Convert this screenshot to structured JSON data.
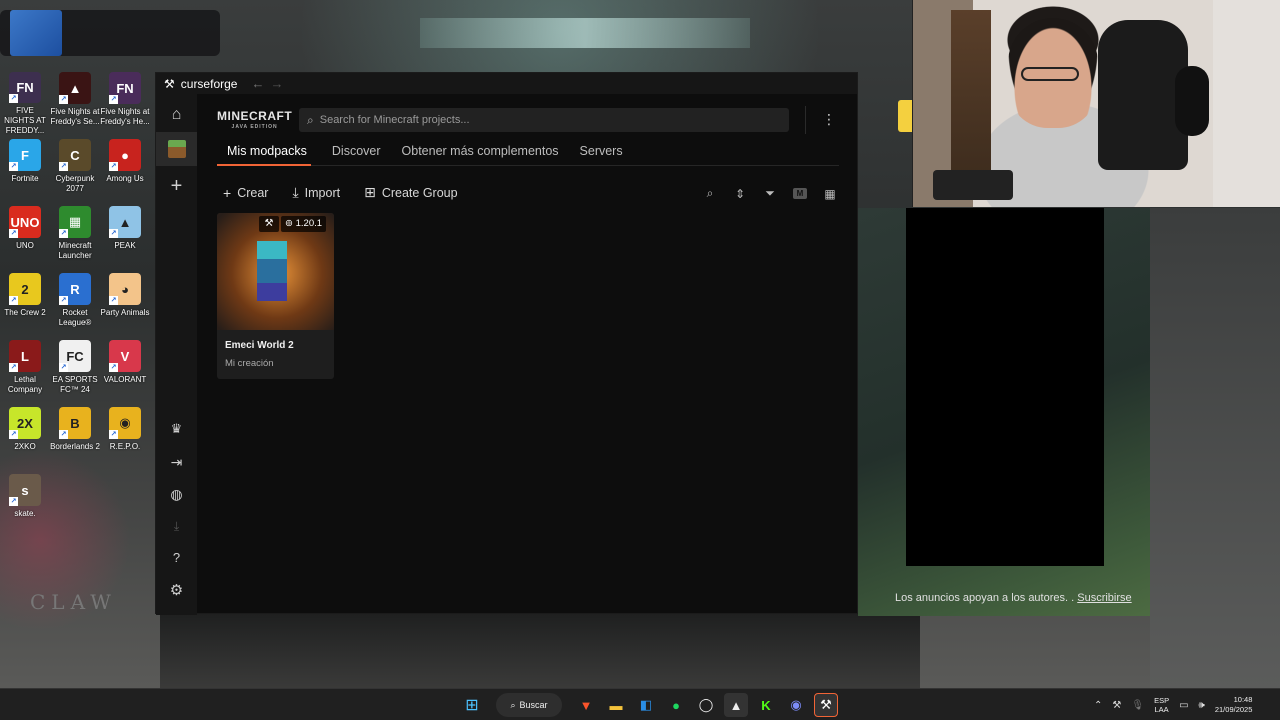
{
  "desktop": {
    "icons": [
      {
        "label": "FIVE NIGHTS AT FREDDY...",
        "color": "#3d2f4f",
        "glyph": "FN"
      },
      {
        "label": "Five Nights at Freddy's Se...",
        "color": "#3a1414",
        "glyph": "▲"
      },
      {
        "label": "Five Nights at Freddy's He...",
        "color": "#4a2c5a",
        "glyph": "FN"
      },
      {
        "label": "Fortnite",
        "color": "#2aa6e8",
        "glyph": "F"
      },
      {
        "label": "Cyberpunk 2077",
        "color": "#5a4a2a",
        "glyph": "C"
      },
      {
        "label": "Among Us",
        "color": "#c8231e",
        "glyph": "●"
      },
      {
        "label": "UNO",
        "color": "#d92b1e",
        "glyph": "UNO"
      },
      {
        "label": "Minecraft Launcher",
        "color": "#2e8b2e",
        "glyph": "▦"
      },
      {
        "label": "PEAK",
        "color": "#8fc3e6",
        "glyph": "▲"
      },
      {
        "label": "The Crew 2",
        "color": "#e8c81e",
        "glyph": "2"
      },
      {
        "label": "Rocket League®",
        "color": "#2a6fd0",
        "glyph": "R"
      },
      {
        "label": "Party Animals",
        "color": "#f3c48a",
        "glyph": "◕"
      },
      {
        "label": "Lethal Company",
        "color": "#8a1a1a",
        "glyph": "L"
      },
      {
        "label": "EA SPORTS FC™ 24",
        "color": "#f0f0f0",
        "glyph": "FC"
      },
      {
        "label": "VALORANT",
        "color": "#d8384b",
        "glyph": "V"
      },
      {
        "label": "2XKO",
        "color": "#c7e62a",
        "glyph": "2X"
      },
      {
        "label": "Borderlands 2",
        "color": "#e8b21e",
        "glyph": "B"
      },
      {
        "label": "R.E.P.O.",
        "color": "#e8b21e",
        "glyph": "◉"
      },
      {
        "label": "skate.",
        "color": "#6a5a4a",
        "glyph": "s"
      }
    ]
  },
  "window": {
    "app_name": "curseforge",
    "back_icon": "←",
    "forward_icon": "→"
  },
  "header": {
    "game_logo": "MINECRAFT",
    "game_edition": "JAVA EDITION",
    "search_placeholder": "Search for Minecraft projects..."
  },
  "tabs": [
    {
      "label": "Mis modpacks",
      "active": true
    },
    {
      "label": "Discover",
      "active": false
    },
    {
      "label": "Obtener más complementos",
      "active": false
    },
    {
      "label": "Servers",
      "active": false
    }
  ],
  "toolbar": {
    "create_label": "Crear",
    "import_label": "Import",
    "create_group_label": "Create Group",
    "view_badge": "M"
  },
  "modpacks": [
    {
      "title": "Emeci World 2",
      "subtitle": "Mi creación",
      "version": "1.20.1"
    }
  ],
  "ad": {
    "text": "Los anuncios apoyan a los autores. .",
    "subscribe_label": "Suscribirse"
  },
  "taskbar": {
    "search_label": "Buscar",
    "lang_line1": "ESP",
    "lang_line2": "LAA",
    "time": "10:48",
    "date": "21/09/2025"
  },
  "colors": {
    "accent": "#f16436",
    "window_bg": "#0d0d0d",
    "sidebar_bg": "#161616"
  }
}
